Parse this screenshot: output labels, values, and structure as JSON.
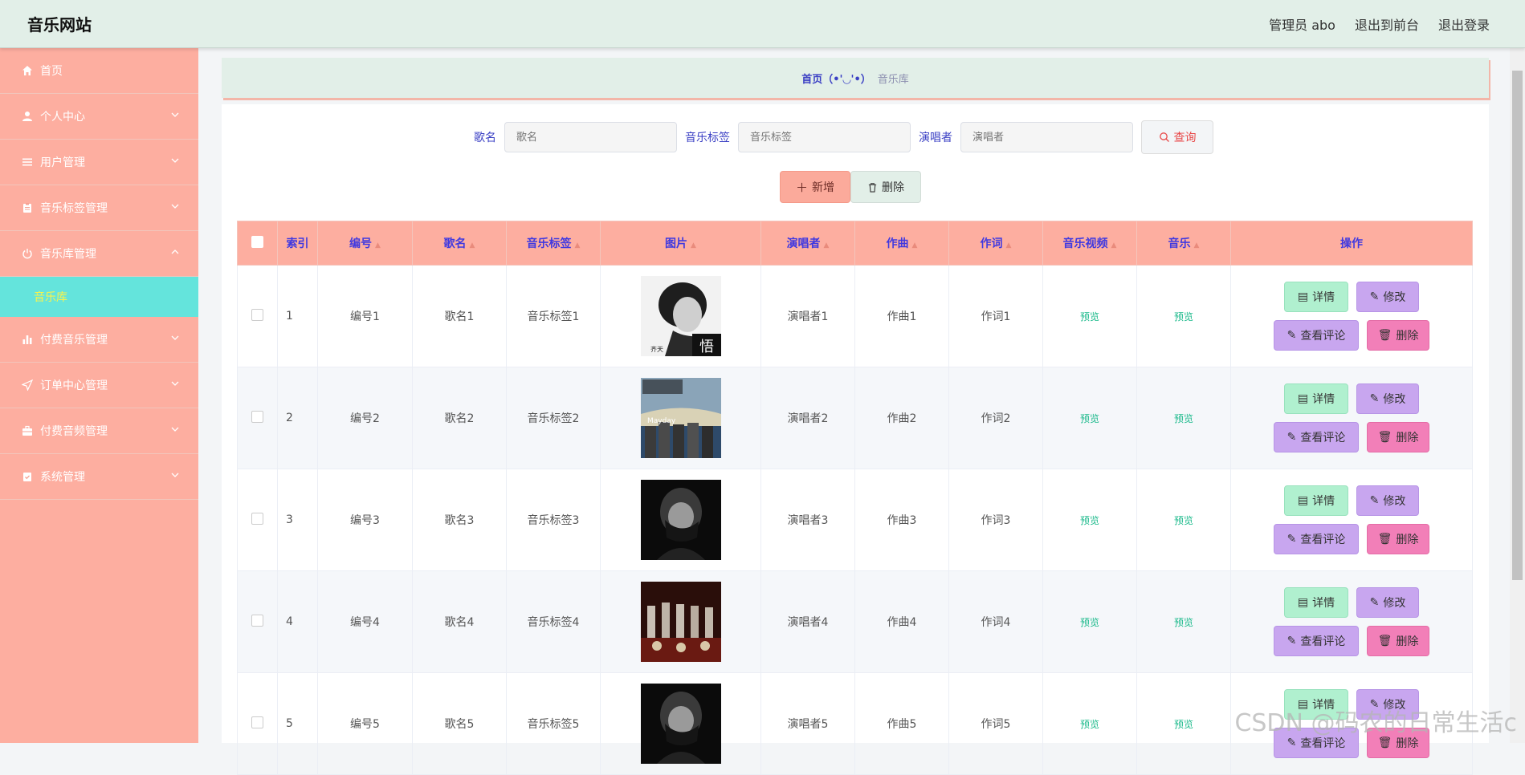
{
  "header": {
    "brand": "音乐网站",
    "admin_label": "管理员 abo",
    "front_label": "退出到前台",
    "logout_label": "退出登录"
  },
  "sidebar": {
    "items": [
      {
        "label": "首页",
        "icon": "home-icon"
      },
      {
        "label": "个人中心",
        "icon": "user-icon"
      },
      {
        "label": "用户管理",
        "icon": "menu-lines-icon"
      },
      {
        "label": "音乐标签管理",
        "icon": "clipboard-icon"
      },
      {
        "label": "音乐库管理",
        "icon": "power-icon"
      },
      {
        "label": "付费音乐管理",
        "icon": "bar-chart-icon"
      },
      {
        "label": "订单中心管理",
        "icon": "send-icon"
      },
      {
        "label": "付费音频管理",
        "icon": "briefcase-icon"
      },
      {
        "label": "系统管理",
        "icon": "calendar-check-icon"
      }
    ],
    "sub_item": "音乐库"
  },
  "breadcrumb": {
    "home": "首页（•'◡'•）",
    "current": "音乐库"
  },
  "search": {
    "song_label": "歌名",
    "song_placeholder": "歌名",
    "tag_label": "音乐标签",
    "tag_placeholder": "音乐标签",
    "singer_label": "演唱者",
    "singer_placeholder": "演唱者",
    "query_label": "查询"
  },
  "actions": {
    "add_label": "新增",
    "delete_label": "删除"
  },
  "table": {
    "headers": {
      "index": "索引",
      "code": "编号",
      "name": "歌名",
      "tag": "音乐标签",
      "image": "图片",
      "singer": "演唱者",
      "composer": "作曲",
      "lyricist": "作词",
      "video": "音乐视频",
      "music": "音乐",
      "ops": "操作"
    },
    "rows": [
      {
        "index": "1",
        "code": "编号1",
        "name": "歌名1",
        "tag": "音乐标签1",
        "singer": "演唱者1",
        "composer": "作曲1",
        "lyricist": "作词1",
        "video": "预览",
        "music": "预览"
      },
      {
        "index": "2",
        "code": "编号2",
        "name": "歌名2",
        "tag": "音乐标签2",
        "singer": "演唱者2",
        "composer": "作曲2",
        "lyricist": "作词2",
        "video": "预览",
        "music": "预览"
      },
      {
        "index": "3",
        "code": "编号3",
        "name": "歌名3",
        "tag": "音乐标签3",
        "singer": "演唱者3",
        "composer": "作曲3",
        "lyricist": "作词3",
        "video": "预览",
        "music": "预览"
      },
      {
        "index": "4",
        "code": "编号4",
        "name": "歌名4",
        "tag": "音乐标签4",
        "singer": "演唱者4",
        "composer": "作曲4",
        "lyricist": "作词4",
        "video": "预览",
        "music": "预览"
      },
      {
        "index": "5",
        "code": "编号5",
        "name": "歌名5",
        "tag": "音乐标签5",
        "singer": "演唱者5",
        "composer": "作曲5",
        "lyricist": "作词5",
        "video": "预览",
        "music": "预览"
      }
    ],
    "op_labels": {
      "detail": "详情",
      "edit": "修改",
      "review": "查看评论",
      "delete": "删除"
    },
    "album_text": {
      "row1": "齐天",
      "row1_big": "悟",
      "row2": "Mayday"
    }
  },
  "watermark": "CSDN @码农的日常生活c",
  "colors": {
    "sidebar_bg": "#fdaea0",
    "header_bg": "#e2efe8",
    "active_sub_bg": "#64e4dc",
    "header_text": "#4039e0",
    "preview_link": "#19b98a"
  }
}
